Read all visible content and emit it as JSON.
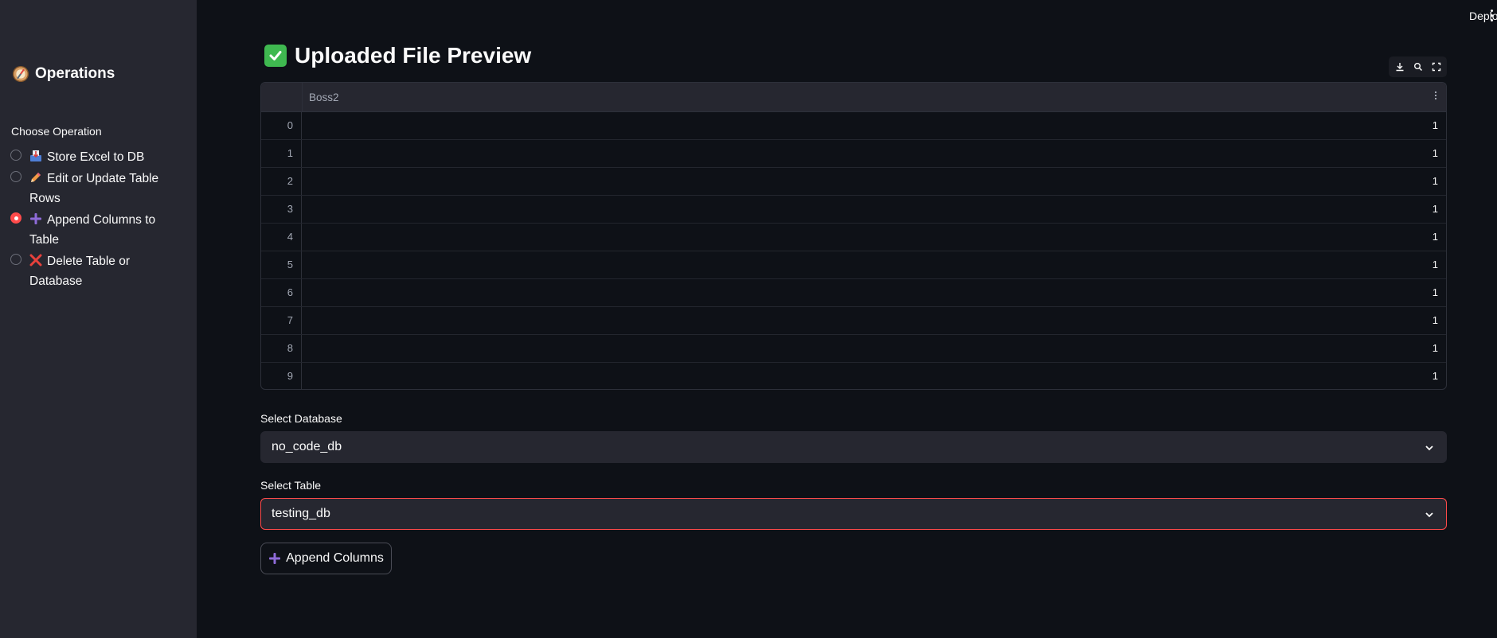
{
  "sidebar": {
    "title": "Operations",
    "radio_label": "Choose Operation",
    "options": [
      {
        "label": "Store Excel to DB",
        "icon": "inbox-tray-icon",
        "checked": false
      },
      {
        "label": "Edit or Update Table Rows",
        "icon": "pencil-icon",
        "checked": false
      },
      {
        "label": "Append Columns to Table",
        "icon": "plus-icon",
        "checked": true
      },
      {
        "label": "Delete Table or Database",
        "icon": "cross-mark-icon",
        "checked": false
      }
    ]
  },
  "header": {
    "deploy_label": "Deploy"
  },
  "main": {
    "title": "Uploaded File Preview",
    "table": {
      "columns": [
        "Boss2"
      ],
      "rows": [
        {
          "index": "0",
          "value": "1"
        },
        {
          "index": "1",
          "value": "1"
        },
        {
          "index": "2",
          "value": "1"
        },
        {
          "index": "3",
          "value": "1"
        },
        {
          "index": "4",
          "value": "1"
        },
        {
          "index": "5",
          "value": "1"
        },
        {
          "index": "6",
          "value": "1"
        },
        {
          "index": "7",
          "value": "1"
        },
        {
          "index": "8",
          "value": "1"
        },
        {
          "index": "9",
          "value": "1"
        }
      ]
    },
    "select_database": {
      "label": "Select Database",
      "value": "no_code_db"
    },
    "select_table": {
      "label": "Select Table",
      "value": "testing_db"
    },
    "append_button": {
      "label": "Append Columns"
    }
  },
  "colors": {
    "background": "#0e1117",
    "sidebar": "#262730",
    "accent": "#ff4b4b",
    "success": "#3fb950",
    "plus": "#8e6bd8"
  }
}
